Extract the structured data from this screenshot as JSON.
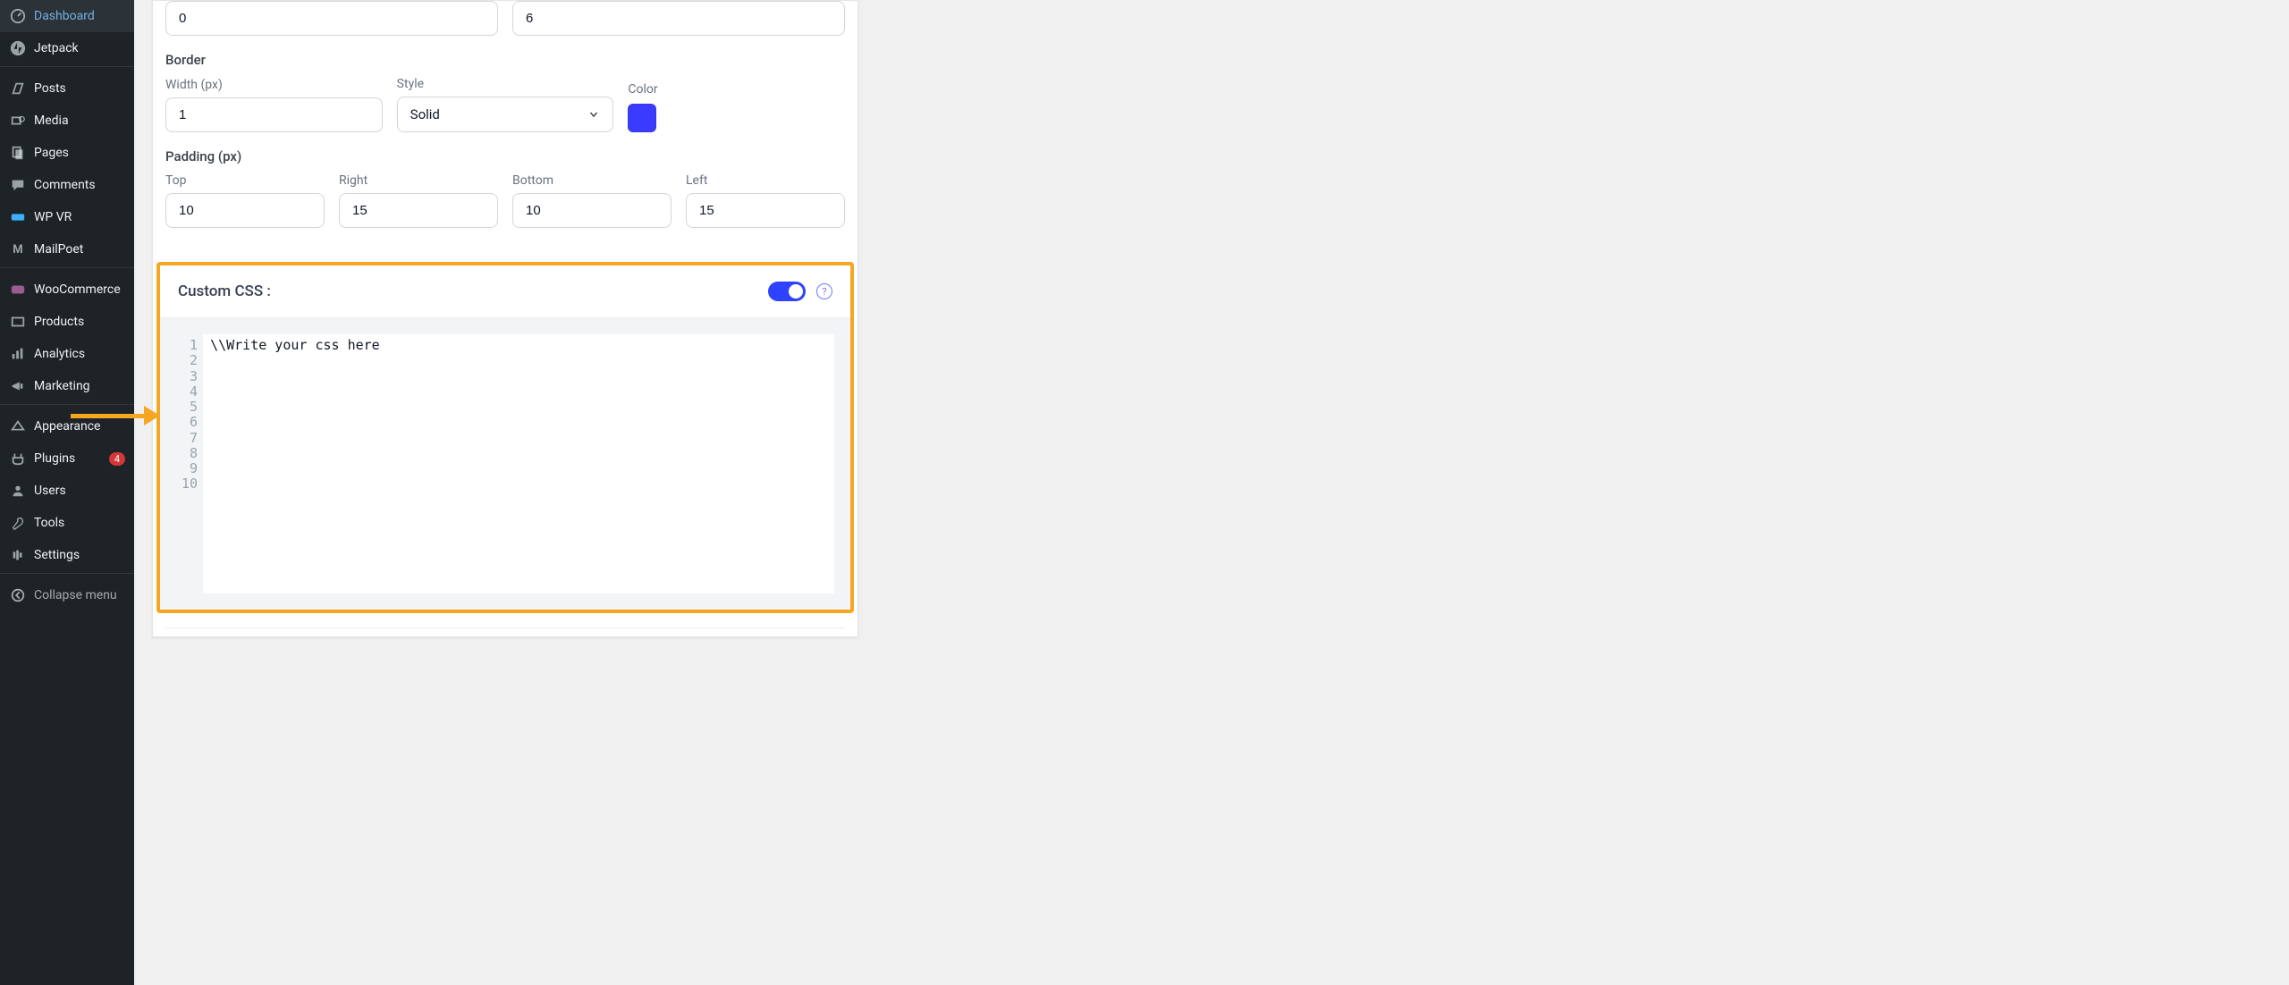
{
  "sidebar": {
    "items": [
      {
        "label": "Dashboard",
        "icon": "dashboard-icon"
      },
      {
        "label": "Jetpack",
        "icon": "jetpack-icon"
      },
      {
        "label": "Posts",
        "icon": "posts-icon"
      },
      {
        "label": "Media",
        "icon": "media-icon"
      },
      {
        "label": "Pages",
        "icon": "pages-icon"
      },
      {
        "label": "Comments",
        "icon": "comments-icon"
      },
      {
        "label": "WP VR",
        "icon": "wpvr-icon"
      },
      {
        "label": "MailPoet",
        "icon": "mailpoet-icon"
      },
      {
        "label": "WooCommerce",
        "icon": "woocommerce-icon"
      },
      {
        "label": "Products",
        "icon": "products-icon"
      },
      {
        "label": "Analytics",
        "icon": "analytics-icon"
      },
      {
        "label": "Marketing",
        "icon": "marketing-icon"
      },
      {
        "label": "Appearance",
        "icon": "appearance-icon"
      },
      {
        "label": "Plugins",
        "icon": "plugins-icon",
        "badge": "4"
      },
      {
        "label": "Users",
        "icon": "users-icon"
      },
      {
        "label": "Tools",
        "icon": "tools-icon"
      },
      {
        "label": "Settings",
        "icon": "settings-icon"
      }
    ],
    "collapse": "Collapse menu"
  },
  "top_row": {
    "left_value": "0",
    "right_value": "6"
  },
  "border": {
    "heading": "Border",
    "width_label": "Width (px)",
    "width_value": "1",
    "style_label": "Style",
    "style_value": "Solid",
    "color_label": "Color",
    "color_hex": "#3b3bff"
  },
  "padding": {
    "heading": "Padding (px)",
    "top_label": "Top",
    "top_value": "10",
    "right_label": "Right",
    "right_value": "15",
    "bottom_label": "Bottom",
    "bottom_value": "10",
    "left_label": "Left",
    "left_value": "15"
  },
  "custom_css": {
    "title": "Custom CSS :",
    "toggle_on": true,
    "code_line1": "\\\\Write your css here",
    "line_numbers": [
      "1",
      "2",
      "3",
      "4",
      "5",
      "6",
      "7",
      "8",
      "9",
      "10"
    ]
  },
  "annotation": {
    "arrow_color": "#f5a623"
  }
}
